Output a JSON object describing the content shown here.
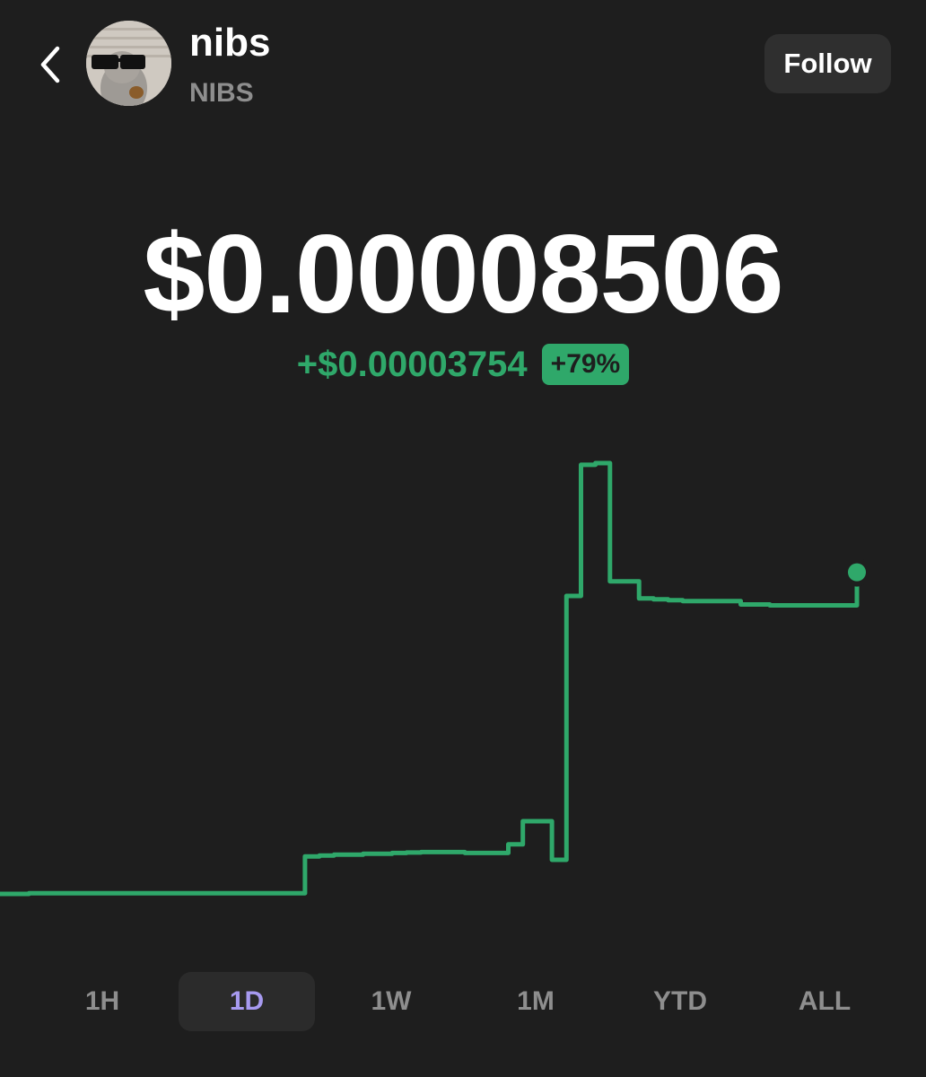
{
  "header": {
    "title": "nibs",
    "ticker": "NIBS",
    "follow_label": "Follow",
    "back_icon": "chevron-left-icon"
  },
  "price": {
    "current": "$0.00008506",
    "change_amount": "+$0.00003754",
    "change_percent": "+79%"
  },
  "colors": {
    "background": "#1e1e1e",
    "accent_green": "#2fa86a",
    "active_tab": "#a79af0",
    "muted": "#8e8e8e"
  },
  "tabs": [
    {
      "label": "1H",
      "active": false
    },
    {
      "label": "1D",
      "active": true
    },
    {
      "label": "1W",
      "active": false
    },
    {
      "label": "1M",
      "active": false
    },
    {
      "label": "YTD",
      "active": false
    },
    {
      "label": "ALL",
      "active": false
    }
  ],
  "chart_data": {
    "type": "line",
    "series": [
      {
        "color": "#2fa86a",
        "values": [
          4.752e-05,
          4.752e-05,
          4.76e-05,
          4.76e-05,
          4.76e-05,
          4.76e-05,
          4.76e-05,
          4.76e-05,
          4.76e-05,
          4.76e-05,
          4.76e-05,
          4.76e-05,
          4.76e-05,
          4.76e-05,
          4.76e-05,
          4.76e-05,
          4.76e-05,
          4.76e-05,
          4.76e-05,
          4.76e-05,
          4.76e-05,
          5.19e-05,
          5.2e-05,
          5.21e-05,
          5.21e-05,
          5.22e-05,
          5.22e-05,
          5.23e-05,
          5.235e-05,
          5.24e-05,
          5.24e-05,
          5.24e-05,
          5.23e-05,
          5.23e-05,
          5.23e-05,
          5.33e-05,
          5.6e-05,
          5.6e-05,
          5.15e-05,
          8.23e-05,
          9.76e-05,
          9.78e-05,
          8.4e-05,
          8.4e-05,
          8.2e-05,
          8.19e-05,
          8.18e-05,
          8.17e-05,
          8.17e-05,
          8.17e-05,
          8.17e-05,
          8.13e-05,
          8.13e-05,
          8.12e-05,
          8.12e-05,
          8.12e-05,
          8.12e-05,
          8.12e-05,
          8.12e-05,
          8.506e-05
        ]
      }
    ]
  }
}
